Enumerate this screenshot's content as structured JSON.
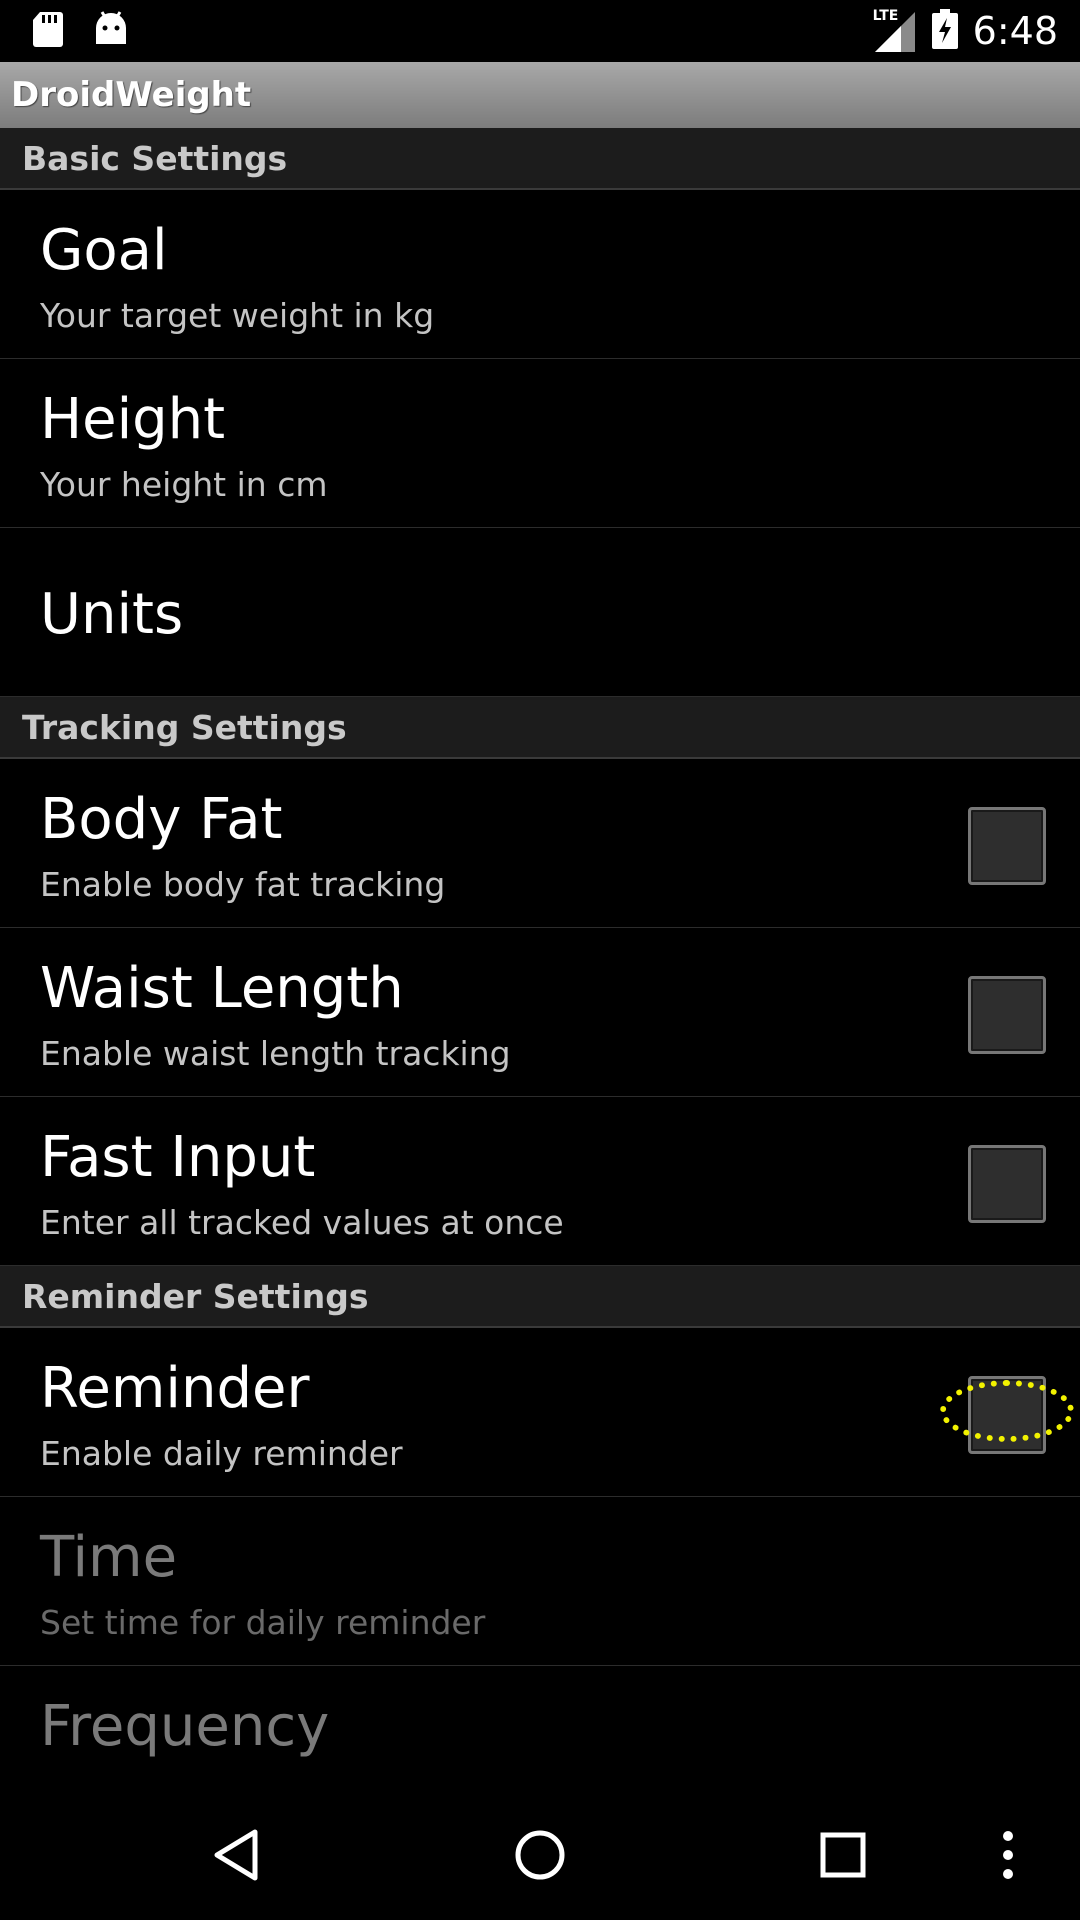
{
  "status_bar": {
    "network": "LTE",
    "time": "6:48"
  },
  "app": {
    "title": "DroidWeight"
  },
  "sections": [
    {
      "title": "Basic Settings",
      "items": [
        {
          "title": "Goal",
          "summary": "Your target weight in kg",
          "checkbox": false,
          "enabled": true
        },
        {
          "title": "Height",
          "summary": "Your height in cm",
          "checkbox": false,
          "enabled": true
        },
        {
          "title": "Units",
          "summary": "",
          "checkbox": false,
          "enabled": true
        }
      ]
    },
    {
      "title": "Tracking Settings",
      "items": [
        {
          "title": "Body Fat",
          "summary": "Enable body fat tracking",
          "checkbox": true,
          "checked": false,
          "enabled": true
        },
        {
          "title": "Waist Length",
          "summary": "Enable waist length tracking",
          "checkbox": true,
          "checked": false,
          "enabled": true
        },
        {
          "title": "Fast Input",
          "summary": "Enter all tracked values at once",
          "checkbox": true,
          "checked": false,
          "enabled": true
        }
      ]
    },
    {
      "title": "Reminder Settings",
      "items": [
        {
          "title": "Reminder",
          "summary": "Enable daily reminder",
          "checkbox": true,
          "checked": false,
          "enabled": true,
          "highlighted": true
        },
        {
          "title": "Time",
          "summary": "Set time for daily reminder",
          "checkbox": false,
          "enabled": false
        },
        {
          "title": "Frequency",
          "summary": "",
          "checkbox": false,
          "enabled": false
        }
      ]
    }
  ],
  "colors": {
    "title_bar": "#8f8f8f",
    "category_bg": "#1c1c1c",
    "highlight": "#f2f200"
  }
}
